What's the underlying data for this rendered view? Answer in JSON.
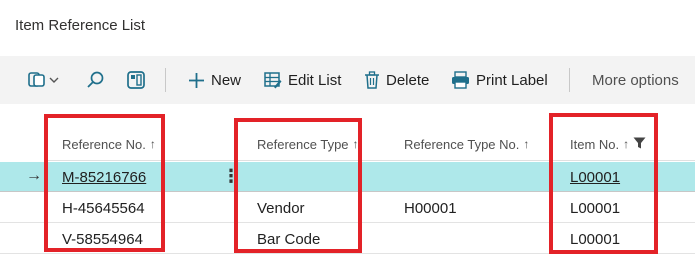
{
  "page": {
    "title": "Item Reference List"
  },
  "toolbar": {
    "new_label": "New",
    "edit_list_label": "Edit List",
    "delete_label": "Delete",
    "print_label": "Print Label",
    "more_label": "More options"
  },
  "columns": {
    "reference_no": "Reference No.",
    "reference_type": "Reference Type",
    "reference_type_no": "Reference Type No.",
    "item_no": "Item No.",
    "sort_arrow": "↑"
  },
  "rows": [
    {
      "reference_no": "M-85216766",
      "reference_type": "",
      "reference_type_no": "",
      "item_no": "L00001",
      "selected": true
    },
    {
      "reference_no": "H-45645564",
      "reference_type": "Vendor",
      "reference_type_no": "H00001",
      "item_no": "L00001",
      "selected": false
    },
    {
      "reference_no": "V-58554964",
      "reference_type": "Bar Code",
      "reference_type_no": "",
      "item_no": "L00001",
      "selected": false
    }
  ],
  "row_indicators": {
    "current_row_arrow": "→",
    "row_actions": "⋮"
  },
  "icons": {
    "view_toggle": "views-icon",
    "search": "search-icon",
    "filter_pane": "filter-pane-icon",
    "new": "plus-icon",
    "edit_list": "edit-list-icon",
    "delete": "trash-icon",
    "print": "printer-icon",
    "column_filter": "funnel-icon"
  },
  "colors": {
    "highlight_border": "#e32228",
    "selected_row": "#aee8ea",
    "toolbar_bg": "#f3f3f3",
    "icon_accent": "#1f6f8b"
  }
}
